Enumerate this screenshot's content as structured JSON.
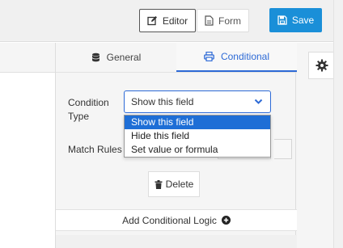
{
  "toolbar": {
    "editor_label": "Editor",
    "form_label": "Form",
    "save_label": "Save"
  },
  "tabs": [
    {
      "label": "General",
      "icon": "database-icon",
      "active": false
    },
    {
      "label": "Conditional",
      "icon": "print-icon",
      "active": true
    }
  ],
  "fields": {
    "condition_type_label": "Condition Type",
    "match_rules_label": "Match Rules",
    "condition_type_value": "Show this field"
  },
  "dropdown": {
    "options": [
      "Show this field",
      "Hide this field",
      "Set value or formula"
    ],
    "selected_index": 0
  },
  "actions": {
    "delete_label": "Delete",
    "add_logic_label": "Add Conditional Logic"
  },
  "colors": {
    "accent": "#2d6ad6",
    "save_bg": "#1a8fd8",
    "selected_option_bg": "#1e6ed6"
  }
}
